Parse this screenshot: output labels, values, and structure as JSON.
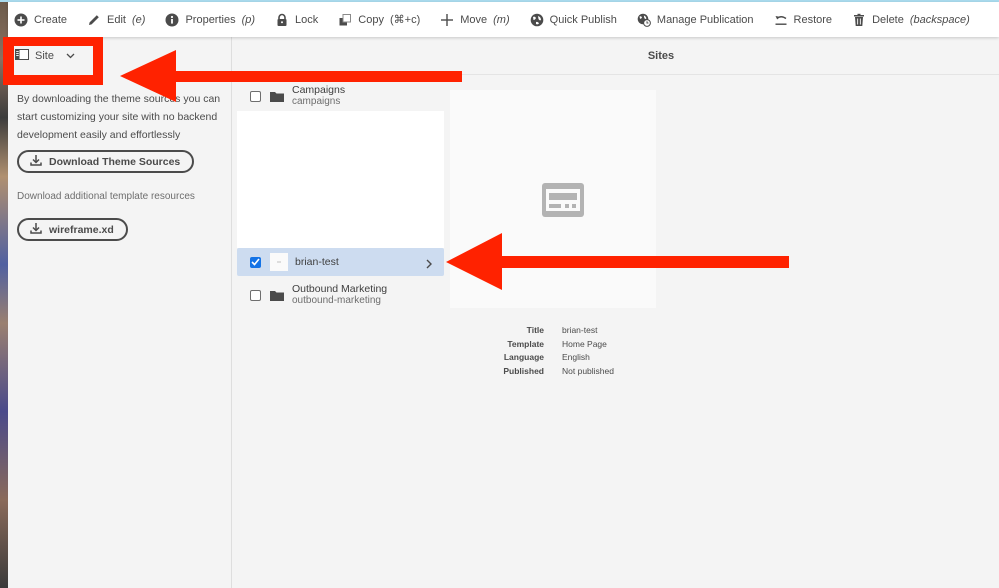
{
  "actionbar": {
    "actions": [
      {
        "label": "Create",
        "shortcut": "",
        "icon": "add-circle-icon"
      },
      {
        "label": "Edit",
        "shortcut": "(e)",
        "icon": "pencil-icon"
      },
      {
        "label": "Properties",
        "shortcut": "(p)",
        "icon": "info-icon"
      },
      {
        "label": "Lock",
        "shortcut": "",
        "icon": "lock-icon"
      },
      {
        "label": "Copy",
        "shortcut": "(⌘+c)",
        "icon": "copy-icon"
      },
      {
        "label": "Move",
        "shortcut": "(m)",
        "icon": "move-icon"
      },
      {
        "label": "Quick Publish",
        "shortcut": "",
        "icon": "globe-icon"
      },
      {
        "label": "Manage Publication",
        "shortcut": "",
        "icon": "globe-clock-icon"
      },
      {
        "label": "Restore",
        "shortcut": "",
        "icon": "restore-icon"
      },
      {
        "label": "Delete",
        "shortcut": "(backspace)",
        "icon": "trash-icon"
      }
    ]
  },
  "rail": {
    "toggle_label": "Site",
    "description": "By downloading the theme sources you can start customizing your site with no backend development easily and effortlessly",
    "download_theme_label": "Download Theme Sources",
    "template_note": "Download additional template resources",
    "wireframe_label": "wireframe.xd"
  },
  "main": {
    "title": "Sites",
    "items": [
      {
        "title": "Campaigns",
        "name": "campaigns",
        "type": "folder",
        "selected": false
      },
      {
        "title": "brian-test",
        "name": "",
        "type": "page",
        "selected": true
      },
      {
        "title": "Outbound Marketing",
        "name": "outbound-marketing",
        "type": "folder",
        "selected": false
      }
    ],
    "preview": {
      "fields": [
        {
          "label": "Title",
          "value": "brian-test"
        },
        {
          "label": "Template",
          "value": "Home Page"
        },
        {
          "label": "Language",
          "value": "English"
        },
        {
          "label": "Published",
          "value": "Not published"
        }
      ]
    }
  },
  "annotation_color": "#ff2200",
  "accent_color": "#1473e6"
}
